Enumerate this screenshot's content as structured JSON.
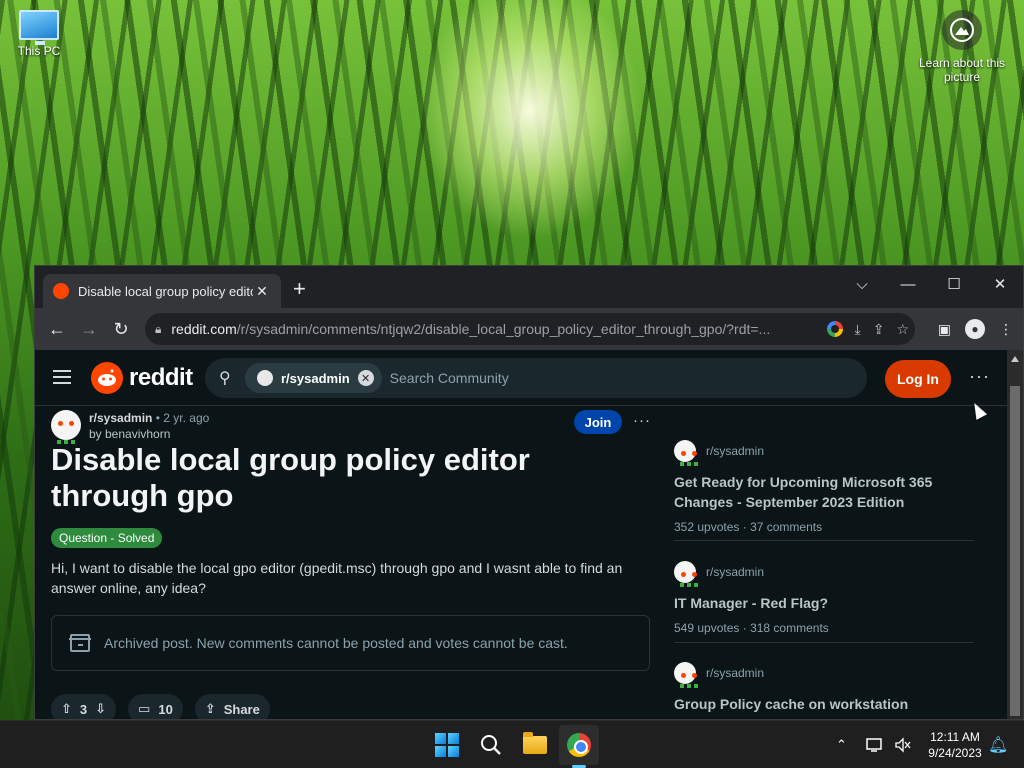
{
  "desktop": {
    "icons": [
      {
        "label": "This PC",
        "icon": "monitor-icon"
      }
    ],
    "learn_label": "Learn about this picture"
  },
  "browser": {
    "tab_title": "Disable local group policy editor",
    "new_tab": "+",
    "window_controls": {
      "dropdown": "⌵",
      "minimize": "—",
      "maximize": "☐",
      "close": "✕"
    },
    "url_host": "reddit.com",
    "url_path": "/r/sysadmin/comments/ntjqw2/disable_local_group_policy_editor_through_gpo/?rdt=..."
  },
  "reddit": {
    "logo_text": "reddit",
    "search_chip": "r/sysadmin",
    "search_placeholder": "Search Community",
    "login_label": "Log In",
    "more": "···",
    "post": {
      "subreddit": "r/sysadmin",
      "time": "• 2 yr. ago",
      "author": "by benavivhorn",
      "join_label": "Join",
      "title": "Disable local group policy editor through gpo",
      "flair": "Question - Solved",
      "body": "Hi, I want to disable the local gpo editor (gpedit.msc) through gpo and I wasnt able to find an answer online, any idea?",
      "archived_text": "Archived post. New comments cannot be posted and votes cannot be cast.",
      "upvotes": "3",
      "comments": "10",
      "share_label": "Share"
    },
    "related": [
      {
        "subreddit": "r/sysadmin",
        "title": "Get Ready for Upcoming Microsoft 365 Changes - September 2023 Edition",
        "upvotes": "352 upvotes",
        "comments": "37 comments"
      },
      {
        "subreddit": "r/sysadmin",
        "title": "IT Manager - Red Flag?",
        "upvotes": "549 upvotes",
        "comments": "318 comments"
      },
      {
        "subreddit": "r/sysadmin",
        "title": "Group Policy cache on workstation",
        "upvotes": "",
        "comments": ""
      }
    ],
    "stats_separator": "·"
  },
  "taskbar": {
    "time": "12:11 AM",
    "date": "9/24/2023"
  },
  "colors": {
    "reddit_orange": "#ff4500",
    "login_bg": "#d93a00",
    "join_bg": "#0045ac",
    "flair_bg": "#2e8b3e",
    "page_bg": "#0b1416"
  }
}
